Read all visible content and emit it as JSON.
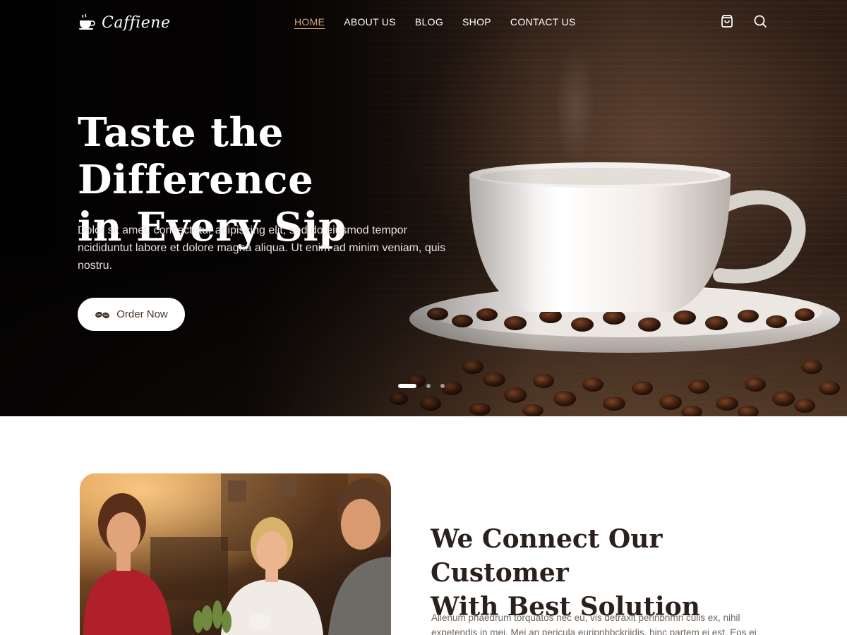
{
  "brand": {
    "name": "Caffiene"
  },
  "nav": {
    "items": [
      {
        "label": "HOME",
        "active": true
      },
      {
        "label": "ABOUT US",
        "active": false
      },
      {
        "label": "BLOG",
        "active": false
      },
      {
        "label": "SHOP",
        "active": false
      },
      {
        "label": "CONTACT US",
        "active": false
      }
    ],
    "icons": [
      "shopping-bag-icon",
      "search-icon"
    ]
  },
  "hero": {
    "title_line1": "Taste the Difference",
    "title_line2": "in Every Sip",
    "description": "Dolor sit amet, consectetur adipiscing elit, sed do eiusmod tempor ncididuntut labore et dolore magna aliqua. Ut enim ad minim veniam, quis nostru.",
    "cta_label": "Order Now",
    "cta_icon": "coffee-beans-icon",
    "slides": {
      "count": 3,
      "active": 1
    }
  },
  "about": {
    "title_line1": "We Connect Our Customer",
    "title_line2": "With Best Solution",
    "text": "Alienum phaedrum torquatos nec eu, vis detraxit perinbnmn culis ex, nihil expetendis in mei. Mei an pericula euripnbbckriidis, hinc partem ei est. Eos ei"
  },
  "colors": {
    "accent": "#d6a27a",
    "hero_dark": "#050403",
    "heading_text": "#2b211c",
    "body_text": "#6f6660",
    "button_text": "#4a3528"
  }
}
